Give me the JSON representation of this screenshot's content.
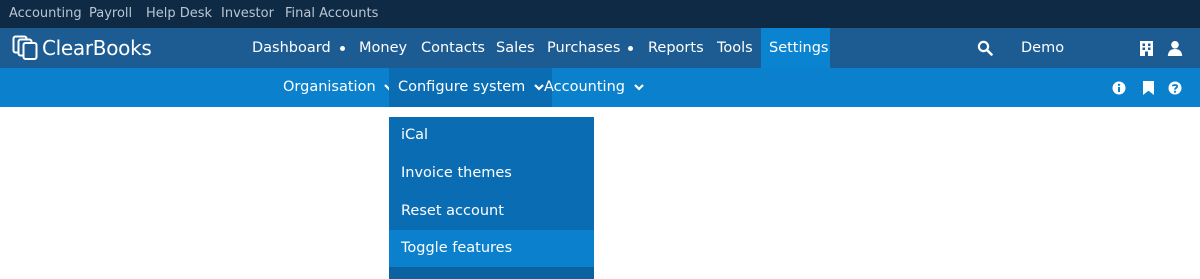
{
  "top_links": [
    "Accounting",
    "Payroll",
    "Help Desk",
    "Investor",
    "Final Accounts"
  ],
  "brand": {
    "name": "ClearBooks"
  },
  "main_nav": {
    "items": [
      "Dashboard",
      "Money",
      "Contacts",
      "Sales",
      "Purchases",
      "Reports",
      "Tools",
      "Settings"
    ],
    "active": "Settings",
    "account_name": "Demo"
  },
  "icons": {
    "search": "search-icon",
    "building": "building-icon",
    "user": "user-icon",
    "info": "info-icon",
    "bookmark": "bookmark-icon",
    "help": "help-icon",
    "chevron": "chevron-down-icon"
  },
  "sub_nav": {
    "items": [
      "Organisation",
      "Configure system",
      "Accounting"
    ],
    "open": "Configure system"
  },
  "dropdown": {
    "items": [
      "iCal",
      "Invoice themes",
      "Reset account",
      "Toggle features"
    ],
    "highlighted": "Toggle features"
  },
  "colors": {
    "top_bar": "#0e2a45",
    "main_bar": "#1d5c93",
    "accent": "#0a84d1",
    "sub_bar": "#0b80cc",
    "dropdown": "#0a6db3"
  }
}
